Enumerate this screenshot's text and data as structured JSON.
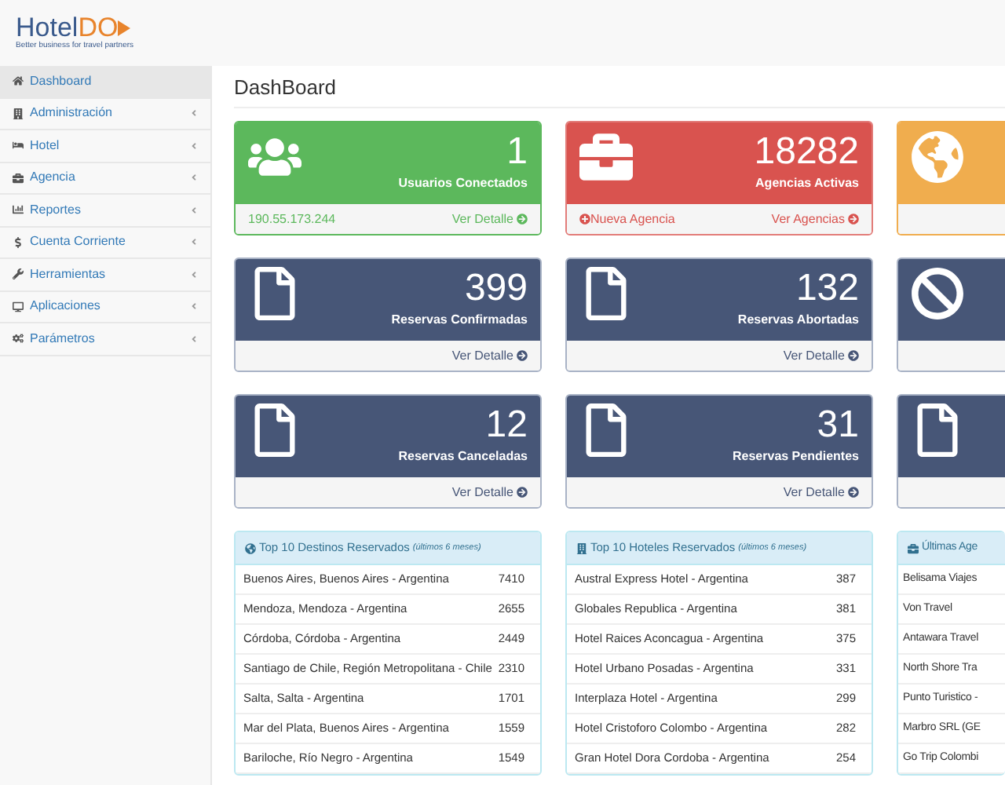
{
  "logo": {
    "brand": "Hotel",
    "brand_accent": "DO",
    "tagline": "Better business for travel partners"
  },
  "sidebar": {
    "items": [
      {
        "label": "Dashboard",
        "selected": true,
        "expandable": false
      },
      {
        "label": "Administración",
        "selected": false,
        "expandable": true
      },
      {
        "label": "Hotel",
        "selected": false,
        "expandable": true
      },
      {
        "label": "Agencia",
        "selected": false,
        "expandable": true
      },
      {
        "label": "Reportes",
        "selected": false,
        "expandable": true
      },
      {
        "label": "Cuenta Corriente",
        "selected": false,
        "expandable": true
      },
      {
        "label": "Herramientas",
        "selected": false,
        "expandable": true
      },
      {
        "label": "Aplicaciones",
        "selected": false,
        "expandable": true
      },
      {
        "label": "Parámetros",
        "selected": false,
        "expandable": true
      }
    ]
  },
  "page_title": "DashBoard",
  "cards": [
    {
      "kind": "success",
      "value": "1",
      "label": "Usuarios Conectados",
      "footer_text": "190.55.173.244",
      "footer_link": "Ver Detalle"
    },
    {
      "kind": "danger",
      "value": "18282",
      "label": "Agencias Activas",
      "footer_action": "Nueva Agencia",
      "footer_link": "Ver Agencias"
    },
    {
      "kind": "warning"
    },
    {
      "kind": "primary",
      "value": "399",
      "label": "Reservas Confirmadas",
      "footer_link": "Ver Detalle"
    },
    {
      "kind": "primary",
      "value": "132",
      "label": "Reservas Abortadas",
      "footer_link": "Ver Detalle"
    },
    {
      "kind": "primary"
    },
    {
      "kind": "primary",
      "value": "12",
      "label": "Reservas Canceladas",
      "footer_link": "Ver Detalle"
    },
    {
      "kind": "primary",
      "value": "31",
      "label": "Reservas Pendientes",
      "footer_link": "Ver Detalle"
    },
    {
      "kind": "primary"
    }
  ],
  "lists": [
    {
      "title": "Top 10 Destinos Reservados",
      "note": "(últimos 6 meses)",
      "rows": [
        {
          "name": "Buenos Aires, Buenos Aires - Argentina",
          "count": "7410"
        },
        {
          "name": "Mendoza, Mendoza - Argentina",
          "count": "2655"
        },
        {
          "name": "Córdoba, Córdoba - Argentina",
          "count": "2449"
        },
        {
          "name": "Santiago de Chile, Región Metropolitana - Chile",
          "count": "2310"
        },
        {
          "name": "Salta, Salta - Argentina",
          "count": "1701"
        },
        {
          "name": "Mar del Plata, Buenos Aires - Argentina",
          "count": "1559"
        },
        {
          "name": "Bariloche, Río Negro - Argentina",
          "count": "1549"
        }
      ]
    },
    {
      "title": "Top 10 Hoteles Reservados",
      "note": "(últimos 6 meses)",
      "rows": [
        {
          "name": "Austral Express Hotel - Argentina",
          "count": "387"
        },
        {
          "name": "Globales Republica - Argentina",
          "count": "381"
        },
        {
          "name": "Hotel Raices Aconcagua - Argentina",
          "count": "375"
        },
        {
          "name": "Hotel Urbano Posadas - Argentina",
          "count": "331"
        },
        {
          "name": "Interplaza Hotel - Argentina",
          "count": "299"
        },
        {
          "name": "Hotel Cristoforo Colombo - Argentina",
          "count": "282"
        },
        {
          "name": "Gran Hotel Dora Cordoba - Argentina",
          "count": "254"
        }
      ]
    },
    {
      "title": "Últimas Age",
      "rows": [
        {
          "name": "Belisama Viajes"
        },
        {
          "name": "Von Travel"
        },
        {
          "name": "Antawara Travel"
        },
        {
          "name": "North Shore Tra"
        },
        {
          "name": "Punto Turistico -"
        },
        {
          "name": "Marbro SRL (GE"
        },
        {
          "name": "Go Trip Colombi"
        }
      ]
    }
  ]
}
